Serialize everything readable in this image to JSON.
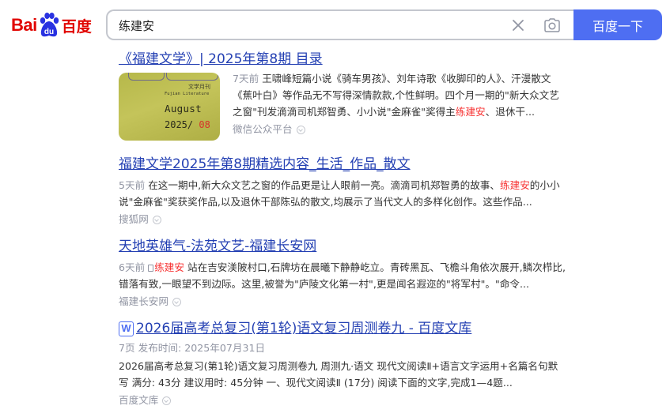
{
  "header": {
    "logo_bai": "Bai",
    "logo_du": "du",
    "logo_cn": "百度",
    "search_value": "练建安",
    "search_button": "百度一下",
    "brand_color": "#e10602",
    "accent_color": "#4e6ef2",
    "icons": [
      "clear-icon",
      "camera-icon"
    ]
  },
  "results": [
    {
      "title": "《福建文学》| 2025年第8期 目录",
      "thumb": {
        "cn": "文学月刊",
        "en": "Fujian Literature",
        "month": "August",
        "year": "2025",
        "issue": "08"
      },
      "date": "7天前",
      "abstract_a": "王啸峰短篇小说《骑车男孩》、刘年诗歌《收脚印的人》、汗漫散文《蕉叶白》等作品无不写得深情款款,个性鲜明。四个月一期的\"新大众文艺之窗\"刊发滴滴司机郑智勇、小小说\"金麻雀\"奖得主",
      "highlight": "练建安",
      "abstract_b": "、退休干...",
      "source": "微信公众平台"
    },
    {
      "title": "福建文学2025年第8期精选内容_生活_作品_散文",
      "date": "5天前",
      "abstract_a": "在这一期中,新大众文艺之窗的作品更是让人眼前一亮。滴滴司机郑智勇的故事、",
      "highlight": "练建安",
      "abstract_b": "的小小说\"金麻雀\"奖获奖作品,以及退休干部陈弘的散文,均展示了当代文人的多样化创作。这些作品...",
      "source": "搜狐网"
    },
    {
      "title": "天地英雄气-法苑文艺-福建长安网",
      "date": "6天前",
      "highlight": "练建安",
      "abstract_b": " 站在吉安渼陂村口,石牌坊在晨曦下静静屹立。青砖黑瓦、飞檐斗角依次展开,鳞次栉比,错落有致,一眼望不到边际。这里,被誉为\"庐陵文化第一村\",更是闻名遐迩的\"将军村\"。\"命令...",
      "source": "福建长安网"
    },
    {
      "title": "2026届高考总复习(第1轮)语文复习周测卷九 - 百度文库",
      "wenku_icon_text": "W",
      "meta": "7页 发布时间: 2025年07月31日",
      "abstract": "2026届高考总复习(第1轮)语文复习周测卷九 周测九·语文 现代文阅读Ⅱ+语言文字运用+名篇名句默写 满分: 43分 建议用时: 45分钟 一、现代文阅读Ⅱ (17分) 阅读下面的文字,完成1—4题...",
      "source": "百度文库"
    }
  ]
}
